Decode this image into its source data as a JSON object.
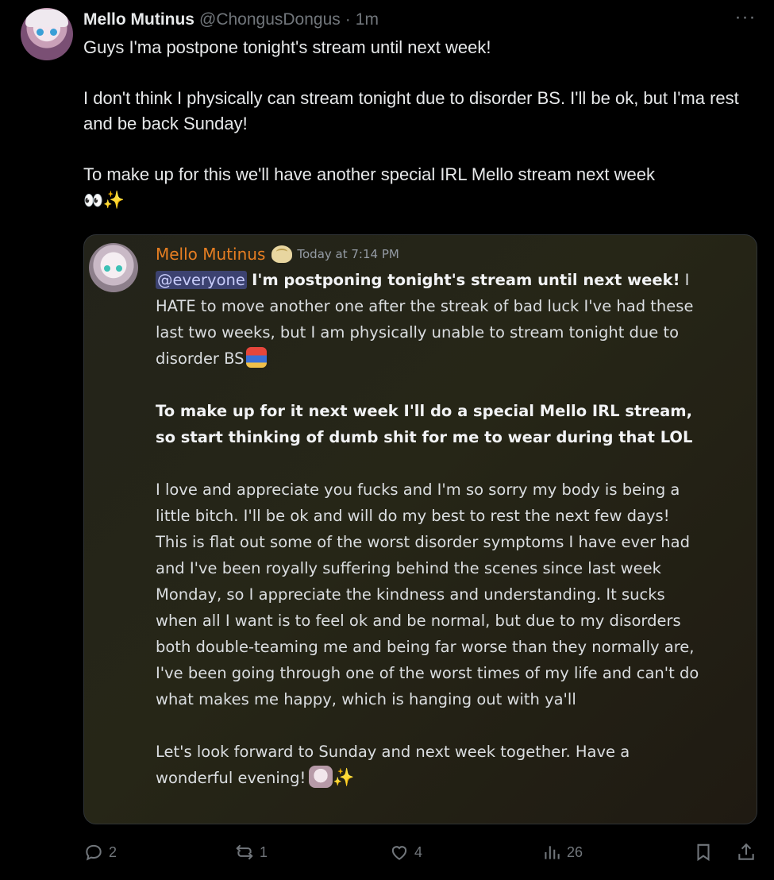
{
  "tweet": {
    "author": {
      "display_name": "Mello Mutinus",
      "handle": "@ChongusDongus",
      "separator": "·",
      "time": "1m"
    },
    "more_label": "···",
    "text": {
      "line1": "Guys I'ma postpone tonight's stream until next week!",
      "para2": "I don't think I physically can stream tonight due to disorder BS.  I'll be ok, but I'ma rest and be back Sunday!",
      "para3": "To make up for this we'll have another special IRL Mello stream next week",
      "emoji_eyes": "👀",
      "emoji_sparkles": "✨"
    },
    "embedded_message": {
      "author": "Mello Mutinus",
      "timestamp": "Today at 7:14 PM",
      "mention": "@everyone",
      "para1_bold": "I'm postponing tonight's stream until next week!",
      "para1_rest": " I HATE to move another one after the streak of bad luck I've had these last two weeks, but I am physically unable to stream tonight due to disorder BS",
      "para2_bold": "To make up for it next week I'll do a special Mello IRL stream, so start thinking of dumb shit for me to wear during that LOL",
      "para3": "I love and appreciate you fucks and I'm so sorry my body is being a little bitch.  I'll be ok and will do my best to rest the next few days! This is flat out some of the worst disorder symptoms I have ever had and I've been royally suffering behind the scenes since last week Monday, so I appreciate the kindness and understanding.  It sucks when all I want is to feel ok and be normal, but due to my disorders both double-teaming me and being far worse than they normally are, I've been going through one of the worst times of my life and can't do what makes me happy, which is hanging out with ya'll",
      "para4": "Let's look forward to Sunday and next week together.  Have a wonderful evening!",
      "emoji_sparkles": "✨"
    },
    "actions": {
      "replies": "2",
      "reposts": "1",
      "likes": "4",
      "views": "26"
    }
  },
  "colors": {
    "background": "#000000",
    "text_primary": "#e7e9ea",
    "text_secondary": "#71767b",
    "discord_name": "#e67e22",
    "mention_bg": "#3c4270"
  }
}
